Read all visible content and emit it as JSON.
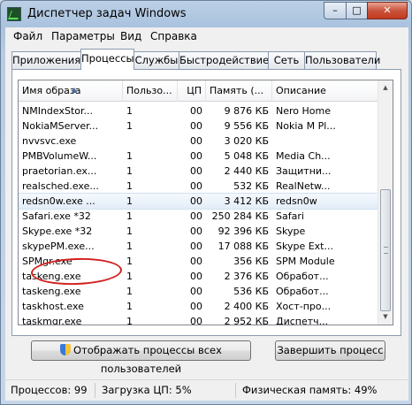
{
  "window": {
    "title": "Диспетчер задач Windows"
  },
  "menu": {
    "items": [
      "Файл",
      "Параметры",
      "Вид",
      "Справка"
    ]
  },
  "tabs": [
    "Приложения",
    "Процессы",
    "Службы",
    "Быстродействие",
    "Сеть",
    "Пользователи"
  ],
  "active_tab": "Процессы",
  "table": {
    "columns": [
      "Имя образа",
      "Пользо...",
      "ЦП",
      "Память (...",
      "Описание"
    ],
    "rows": [
      [
        "NMIndexStor...",
        "1",
        "00",
        "9 876 КБ",
        "Nero Home"
      ],
      [
        "NokiaMServer...",
        "1",
        "00",
        "9 556 КБ",
        "Nokia M Pl..."
      ],
      [
        "nvvsvc.exe",
        "",
        "00",
        "3 020 КБ",
        ""
      ],
      [
        "PMBVolumeW...",
        "1",
        "00",
        "5 048 КБ",
        "Media Ch..."
      ],
      [
        "praetorian.ex...",
        "1",
        "00",
        "2 440 КБ",
        "Защитни..."
      ],
      [
        "realsched.exe...",
        "1",
        "00",
        "532 КБ",
        "RealNetw..."
      ],
      [
        "redsn0w.exe ...",
        "1",
        "00",
        "3 412 КБ",
        "redsn0w"
      ],
      [
        "Safari.exe *32",
        "1",
        "00",
        "250 284 КБ",
        "Safari"
      ],
      [
        "Skype.exe *32",
        "1",
        "00",
        "92 396 КБ",
        "Skype"
      ],
      [
        "skypePM.exe...",
        "1",
        "00",
        "17 088 КБ",
        "Skype Ext..."
      ],
      [
        "SPMgr.exe",
        "1",
        "00",
        "356 КБ",
        "SPM Module"
      ],
      [
        "taskeng.exe",
        "1",
        "00",
        "2 376 КБ",
        "Обработ..."
      ],
      [
        "taskeng.exe",
        "1",
        "00",
        "536 КБ",
        "Обработ..."
      ],
      [
        "taskhost.exe",
        "1",
        "00",
        "2 400 КБ",
        "Хост-про..."
      ],
      [
        "taskmgr.exe",
        "1",
        "00",
        "2 952 КБ",
        "Диспетч..."
      ]
    ],
    "selected_row": "redsn0w.exe ..."
  },
  "buttons": {
    "show_all": "Отображать процессы всех пользователей",
    "end_process": "Завершить процесс"
  },
  "status": {
    "processes": "Процессов: 99",
    "cpu": "Загрузка ЦП: 5%",
    "memory": "Физическая память: 49%"
  },
  "icons": {
    "app": "task-manager-icon",
    "shield": "uac-shield-icon"
  },
  "colors": {
    "annotation_circle": "#d32020",
    "close_button": "#c43a1e"
  }
}
